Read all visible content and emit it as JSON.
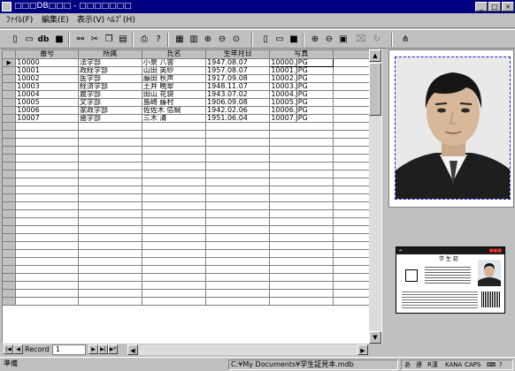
{
  "window": {
    "title": "□□□DB□□□ - □□□□□□□"
  },
  "menu": {
    "items": [
      {
        "label": "ﾌｧｲﾙ(F)"
      },
      {
        "label": "編集(E)"
      },
      {
        "label": "表示(V)"
      },
      {
        "label": "ﾍﾙﾌﾟ(H)"
      }
    ]
  },
  "toolbar": {
    "db_label": "db",
    "buttons": [
      "new-icon",
      "open-icon",
      "db-icon",
      "save-icon",
      "find-icon",
      "cut-icon",
      "copy-icon",
      "paste-icon",
      "print-icon",
      "help-icon",
      "grid-view-icon",
      "record-view-icon",
      "zoom-in-icon",
      "zoom-out-icon",
      "zoom-fit-icon",
      "new-image-icon",
      "open-image-icon",
      "save-image-icon",
      "image-zoom-in-icon",
      "image-zoom-out-icon",
      "image-fit-icon",
      "crop-icon",
      "rotate-icon",
      "tree-icon"
    ]
  },
  "table": {
    "columns": [
      "番号",
      "所属",
      "氏名",
      "生年月日",
      "写真"
    ],
    "rows": [
      {
        "id": "10000",
        "dept": "法学部",
        "name": "小泉 八雲",
        "birth": "1947.08.07",
        "photo": "10000.JPG"
      },
      {
        "id": "10001",
        "dept": "政経学部",
        "name": "山田 英紗",
        "birth": "1957.08.07",
        "photo": "10001.JPG"
      },
      {
        "id": "10002",
        "dept": "医学部",
        "name": "藤田 秋声",
        "birth": "1917.09.08",
        "photo": "10002.JPG"
      },
      {
        "id": "10003",
        "dept": "経済学部",
        "name": "土井 晩翠",
        "birth": "1948.11.07",
        "photo": "10003.JPG"
      },
      {
        "id": "10004",
        "dept": "農学部",
        "name": "田山 花袋",
        "birth": "1943.07.02",
        "photo": "10004.JPG"
      },
      {
        "id": "10005",
        "dept": "文学部",
        "name": "島崎 藤村",
        "birth": "1906.09.08",
        "photo": "10005.JPG"
      },
      {
        "id": "10006",
        "dept": "家政学部",
        "name": "佐佐木 信綱",
        "birth": "1942.02.06",
        "photo": "10006.JPG"
      },
      {
        "id": "10007",
        "dept": "歯学部",
        "name": "三木 清",
        "birth": "1951.06.04",
        "photo": "10007.JPG"
      }
    ],
    "empty_rows": 23
  },
  "navigator": {
    "label": "Record",
    "value": "1"
  },
  "id_card": {
    "title": "学 生 証"
  },
  "status": {
    "ready": "準備",
    "path": "C:¥My Documents¥学生証見本.mdb",
    "tray": [
      "あ",
      "連",
      "R漢",
      "KANA",
      "CAPS",
      "⌨",
      "?"
    ]
  }
}
